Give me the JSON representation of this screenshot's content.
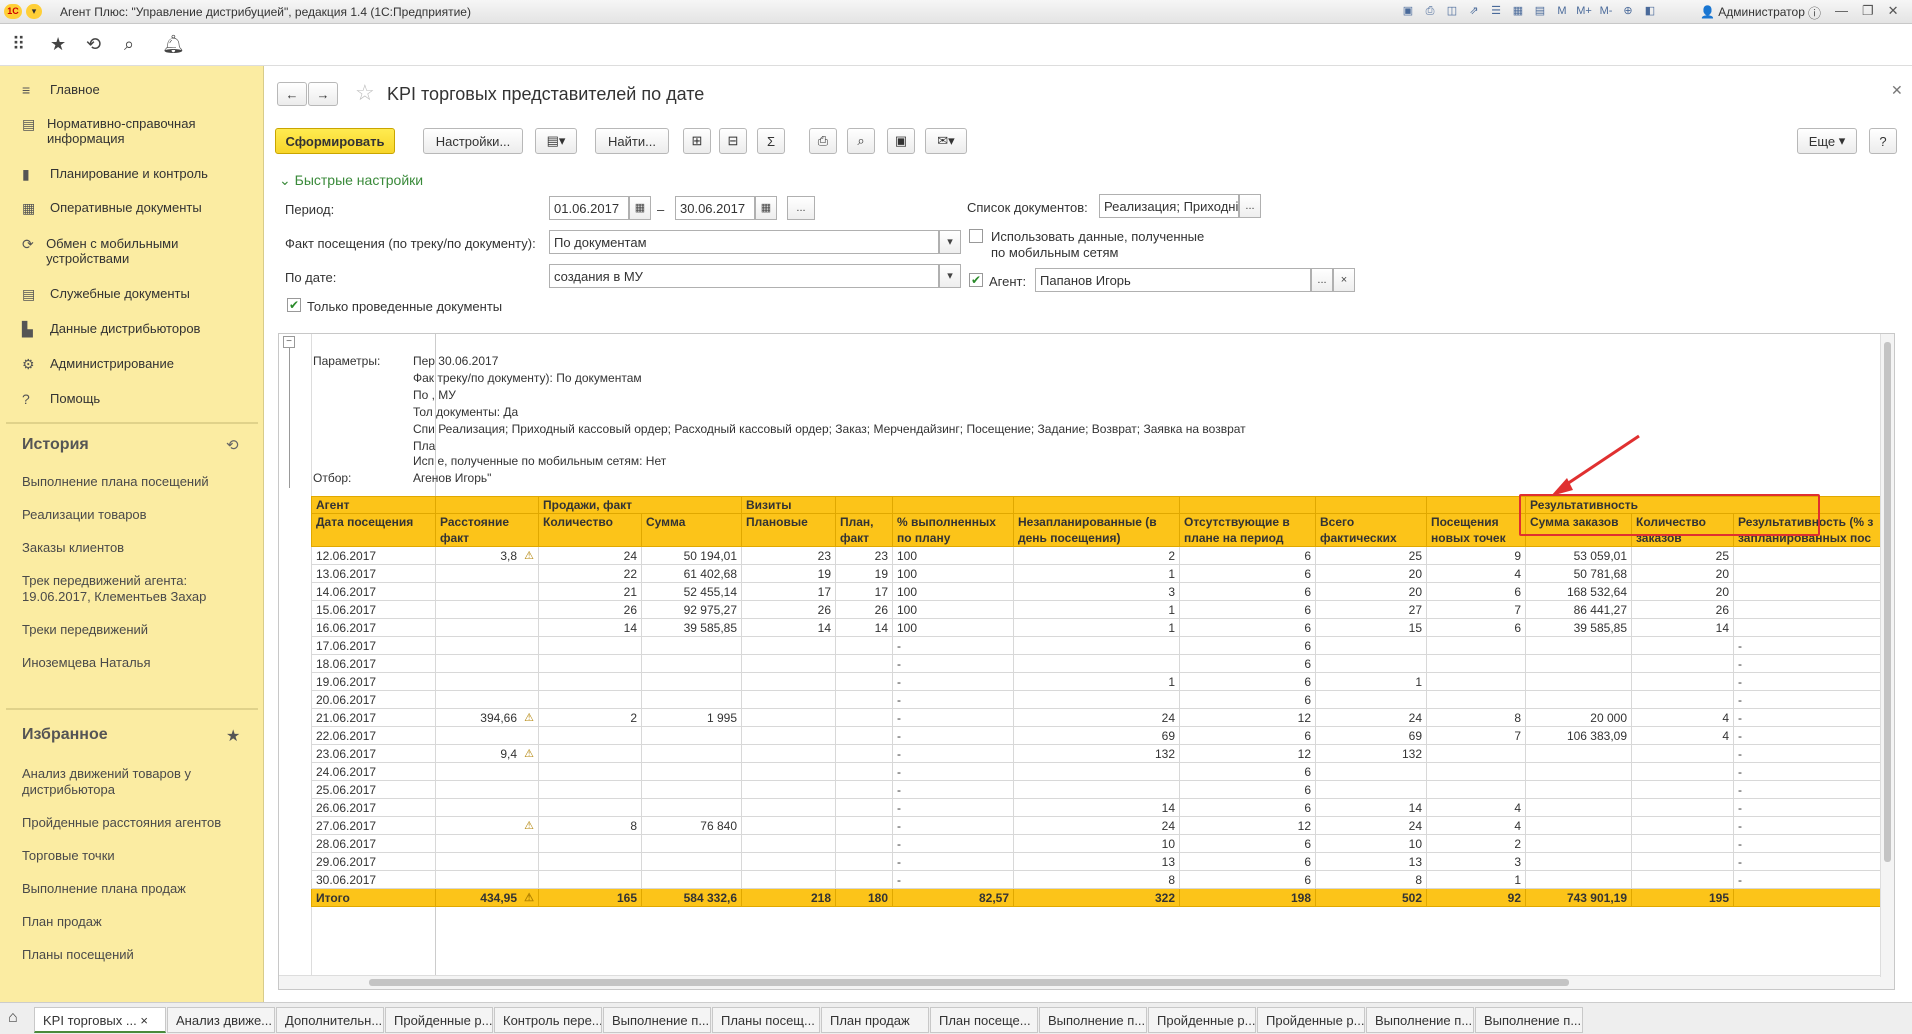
{
  "app": {
    "title": "Агент Плюс: \"Управление дистрибуцией\", редакция 1.4  (1С:Предприятие)",
    "user": "Администратор"
  },
  "sidebar": {
    "items": [
      {
        "label": "Главное",
        "icon": "menu-icon"
      },
      {
        "label": "Нормативно-справочная информация",
        "icon": "list-icon"
      },
      {
        "label": "Планирование и контроль",
        "icon": "chart-icon"
      },
      {
        "label": "Оперативные документы",
        "icon": "docs-icon"
      },
      {
        "label": "Обмен с мобильными устройствами",
        "icon": "sync-icon"
      },
      {
        "label": "Служебные документы",
        "icon": "service-docs-icon"
      },
      {
        "label": "Данные дистрибьюторов",
        "icon": "distributor-icon"
      },
      {
        "label": "Администрирование",
        "icon": "gear-icon"
      },
      {
        "label": "Помощь",
        "icon": "help-icon"
      }
    ],
    "history_title": "История",
    "history": [
      "Выполнение плана посещений",
      "Реализации товаров",
      "Заказы клиентов",
      "Трек передвижений агента: 19.06.2017, Клементьев Захар",
      "Треки передвижений",
      "Иноземцева Наталья"
    ],
    "favorites_title": "Избранное",
    "favorites": [
      "Анализ движений товаров у дистрибьютора",
      "Пройденные расстояния агентов",
      "Торговые точки",
      "Выполнение плана продаж",
      "План продаж",
      "Планы посещений"
    ]
  },
  "form": {
    "title": "KPI торговых представителей по дате",
    "generate": "Сформировать",
    "settings": "Настройки...",
    "find": "Найти...",
    "more": "Еще",
    "help": "?",
    "quick_settings": "Быстрые настройки",
    "period_label": "Период:",
    "date_from": "01.06.2017",
    "date_to": "30.06.2017",
    "dash": "–",
    "ellipsis": "...",
    "visit_label": "Факт посещения (по треку/по документу):",
    "visit_value": "По документам",
    "bydate_label": "По дате:",
    "bydate_value": "создания в МУ",
    "only_posted": "Только проведенные документы",
    "doclist_label": "Список документов:",
    "doclist_value": "Реализация; Приходні",
    "use_mobile": "Использовать данные, полученные по мобильным сетям",
    "agent_label": "Агент:",
    "agent_value": "Папанов Игорь",
    "clear": "×"
  },
  "params": {
    "label": "Параметры:",
    "filter_label": "Отбор:",
    "lines": [
      "Пер 30.06.2017",
      "Фак треку/по документу): По документам",
      "По , МУ",
      "Тол документы: Да",
      "Спи Реализация; Приходный кассовый ордер; Расходный кассовый ордер; Заказ; Мерчендайзинг; Посещение; Задание; Возврат; Заявка на возврат",
      "Пла",
      "Исп е, полученные по мобильным сетям: Нет",
      "Агенов Игорь\""
    ]
  },
  "table": {
    "group_row": [
      "Агент",
      "",
      "Продажи, факт",
      "",
      "Визиты",
      "",
      "",
      "",
      "",
      "",
      "",
      "",
      "Результативность",
      "",
      ""
    ],
    "header_row": [
      "Дата посещения",
      "Расстояние факт",
      "Количество",
      "Сумма",
      "Плановые",
      "План, факт",
      "% выполненных по плану",
      "Незапланированные (в день посещения)",
      "Отсутствующие в плане на период",
      "Всего фактических",
      "Посещения новых точек",
      "Сумма заказов",
      "Количество заказов",
      "Результативность (% з запланированных пос"
    ],
    "rows": [
      [
        "12.06.2017",
        "3,8",
        "24",
        "50 194,01",
        "23",
        "23",
        "100",
        "2",
        "6",
        "25",
        "9",
        "53 059,01",
        "25",
        ""
      ],
      [
        "13.06.2017",
        "",
        "22",
        "61 402,68",
        "19",
        "19",
        "100",
        "1",
        "6",
        "20",
        "4",
        "50 781,68",
        "20",
        ""
      ],
      [
        "14.06.2017",
        "",
        "21",
        "52 455,14",
        "17",
        "17",
        "100",
        "3",
        "6",
        "20",
        "6",
        "168 532,64",
        "20",
        ""
      ],
      [
        "15.06.2017",
        "",
        "26",
        "92 975,27",
        "26",
        "26",
        "100",
        "1",
        "6",
        "27",
        "7",
        "86 441,27",
        "26",
        ""
      ],
      [
        "16.06.2017",
        "",
        "14",
        "39 585,85",
        "14",
        "14",
        "100",
        "1",
        "6",
        "15",
        "6",
        "39 585,85",
        "14",
        ""
      ],
      [
        "17.06.2017",
        "",
        "",
        "",
        "",
        "",
        "-",
        "",
        "6",
        "",
        "",
        "",
        "",
        "-"
      ],
      [
        "18.06.2017",
        "",
        "",
        "",
        "",
        "",
        "-",
        "",
        "6",
        "",
        "",
        "",
        "",
        "-"
      ],
      [
        "19.06.2017",
        "",
        "",
        "",
        "",
        "",
        "-",
        "1",
        "6",
        "1",
        "",
        "",
        "",
        "-"
      ],
      [
        "20.06.2017",
        "",
        "",
        "",
        "",
        "",
        "-",
        "",
        "6",
        "",
        "",
        "",
        "",
        "-"
      ],
      [
        "21.06.2017",
        "394,66",
        "2",
        "1 995",
        "",
        "",
        "-",
        "24",
        "12",
        "24",
        "8",
        "20 000",
        "4",
        "-"
      ],
      [
        "22.06.2017",
        "",
        "",
        "",
        "",
        "",
        "-",
        "69",
        "6",
        "69",
        "7",
        "106 383,09",
        "4",
        "-"
      ],
      [
        "23.06.2017",
        "9,4",
        "",
        "",
        "",
        "",
        "-",
        "132",
        "12",
        "132",
        "",
        "",
        "",
        "-"
      ],
      [
        "24.06.2017",
        "",
        "",
        "",
        "",
        "",
        "-",
        "",
        "6",
        "",
        "",
        "",
        "",
        "-"
      ],
      [
        "25.06.2017",
        "",
        "",
        "",
        "",
        "",
        "-",
        "",
        "6",
        "",
        "",
        "",
        "",
        "-"
      ],
      [
        "26.06.2017",
        "",
        "",
        "",
        "",
        "",
        "-",
        "14",
        "6",
        "14",
        "4",
        "",
        "",
        "-"
      ],
      [
        "27.06.2017",
        "",
        "8",
        "76 840",
        "",
        "",
        "-",
        "24",
        "12",
        "24",
        "4",
        "",
        "",
        "-"
      ],
      [
        "28.06.2017",
        "",
        "",
        "",
        "",
        "",
        "-",
        "10",
        "6",
        "10",
        "2",
        "",
        "",
        "-"
      ],
      [
        "29.06.2017",
        "",
        "",
        "",
        "",
        "",
        "-",
        "13",
        "6",
        "13",
        "3",
        "",
        "",
        "-"
      ],
      [
        "30.06.2017",
        "",
        "",
        "",
        "",
        "",
        "-",
        "8",
        "6",
        "8",
        "1",
        "",
        "",
        "-"
      ]
    ],
    "warn_rows": [
      0,
      9,
      11,
      15
    ],
    "total": [
      "Итого",
      "434,95",
      "165",
      "584 332,6",
      "218",
      "180",
      "82,57",
      "322",
      "198",
      "502",
      "92",
      "743 901,19",
      "195",
      ""
    ]
  },
  "tabs": [
    "KPI торговых ...",
    "Анализ движе...",
    "Дополнительн...",
    "Пройденные р...",
    "Контроль пере...",
    "Выполнение п...",
    "Планы посещ...",
    "План продаж",
    "План посеще...",
    "Выполнение п...",
    "Пройденные р...",
    "Пройденные р...",
    "Выполнение п...",
    "Выполнение п..."
  ],
  "colors": {
    "sidebar": "#fbeca2",
    "accent": "#fcc419",
    "highlight": "#e03030"
  }
}
